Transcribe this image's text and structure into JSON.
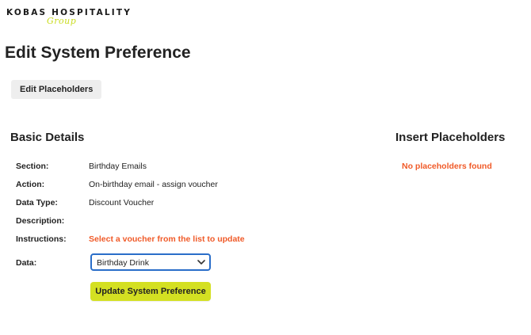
{
  "logo": {
    "main": "KOBAS HOSPITALITY",
    "script": "Group"
  },
  "page": {
    "title": "Edit System Preference"
  },
  "toolbar": {
    "edit_placeholders_label": "Edit Placeholders"
  },
  "basic_details": {
    "heading": "Basic Details",
    "fields": [
      {
        "label": "Section:",
        "value": "Birthday Emails"
      },
      {
        "label": "Action:",
        "value": "On-birthday email - assign voucher"
      },
      {
        "label": "Data Type:",
        "value": "Discount Voucher"
      },
      {
        "label": "Description:",
        "value": ""
      },
      {
        "label": "Instructions:",
        "value": "Select a voucher from the list to update"
      },
      {
        "label": "Data:",
        "value": "Birthday Drink"
      }
    ],
    "submit_label": "Update System Preference"
  },
  "insert_placeholders": {
    "heading": "Insert Placeholders",
    "empty_message": "No placeholders found"
  },
  "colors": {
    "accent": "#d4e022",
    "warning_text": "#f05a28",
    "focus_border": "#2a6ec9"
  }
}
